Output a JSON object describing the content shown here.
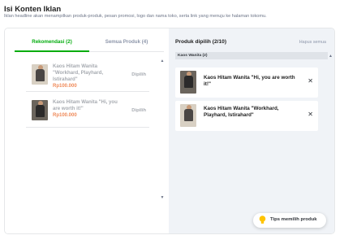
{
  "header": {
    "title": "Isi Konten Iklan",
    "subtitle": "Iklan headline akan menampilkan produk-produk, pesan promosi, logo dan nama toko, serta link yang menuju ke halaman tokomu."
  },
  "tabs": [
    {
      "label": "Rekomendasi (2)",
      "active": true
    },
    {
      "label": "Semua Produk (4)",
      "active": false
    }
  ],
  "product_list": [
    {
      "name": "Kaos Hitam Wanita \"Workhard, Playhard, Istirahard\"",
      "price": "Rp100.000",
      "status": "Dipilih"
    },
    {
      "name": "Kaos Hitam Wanita \"Hi, you are worth it!\"",
      "price": "Rp100.000",
      "status": "Dipilih"
    }
  ],
  "selected_panel": {
    "title": "Produk dipilih (2/10)",
    "clear_all": "Hapus semua",
    "group_label": "Kaos Wanita (2)",
    "items": [
      {
        "name": "Kaos Hitam Wanita \"Hi, you are worth it!\""
      },
      {
        "name": "Kaos Hitam Wanita \"Workhard, Playhard, Istirahard\""
      }
    ]
  },
  "tips": {
    "label": "Tips memilih produk"
  },
  "colors": {
    "accent": "#03ac0e",
    "price": "#ef8a59",
    "tips_icon": "#ffc400"
  }
}
